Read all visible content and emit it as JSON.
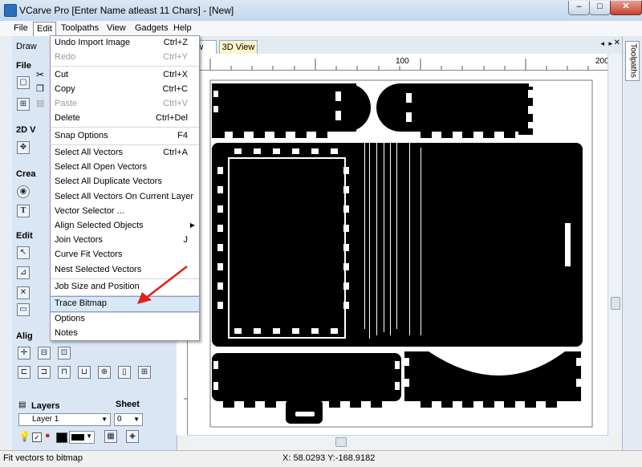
{
  "window": {
    "title": "VCarve Pro [Enter Name atleast 11 Chars] - [New]",
    "min_glyph": "–",
    "max_glyph": "□",
    "close_glyph": "✕"
  },
  "menubar": {
    "items": [
      "File",
      "Edit",
      "Toolpaths",
      "View",
      "Gadgets",
      "Help"
    ]
  },
  "left_panel": {
    "drawing_tab": "Draw",
    "section_file": "File",
    "section_2d": "2D V",
    "section_create": "Crea",
    "section_edit": "Edit",
    "section_align": "Alig",
    "layers_label": "Layers",
    "sheet_label": "Sheet",
    "layer_value": "Layer 1",
    "sheet_value": "0"
  },
  "view_tabs": {
    "tab_2d": "iew",
    "tab_3d": "3D View"
  },
  "ruler": {
    "mark_100": "100",
    "mark_200": "200"
  },
  "right_panel": {
    "toolpaths": "Toolpaths"
  },
  "edit_menu": {
    "items": [
      {
        "label": "Undo Import Image",
        "shortcut": "Ctrl+Z"
      },
      {
        "label": "Redo",
        "shortcut": "Ctrl+Y"
      },
      {
        "label": "Cut",
        "shortcut": "Ctrl+X"
      },
      {
        "label": "Copy",
        "shortcut": "Ctrl+C"
      },
      {
        "label": "Paste",
        "shortcut": "Ctrl+V"
      },
      {
        "label": "Delete",
        "shortcut": "Ctrl+Del"
      },
      {
        "label": "Snap Options",
        "shortcut": "F4"
      },
      {
        "label": "Select All Vectors",
        "shortcut": "Ctrl+A"
      },
      {
        "label": "Select All Open Vectors",
        "shortcut": ""
      },
      {
        "label": "Select All Duplicate Vectors",
        "shortcut": ""
      },
      {
        "label": "Select All Vectors On Current Layer",
        "shortcut": ""
      },
      {
        "label": "Vector Selector ...",
        "shortcut": ""
      },
      {
        "label": "Align Selected Objects",
        "shortcut": ""
      },
      {
        "label": "Join Vectors",
        "shortcut": "J"
      },
      {
        "label": "Curve Fit Vectors",
        "shortcut": ""
      },
      {
        "label": "Nest Selected Vectors",
        "shortcut": ""
      },
      {
        "label": "Job Size and Position",
        "shortcut": ""
      },
      {
        "label": "Trace Bitmap",
        "shortcut": ""
      },
      {
        "label": "Options",
        "shortcut": ""
      },
      {
        "label": "Notes",
        "shortcut": ""
      }
    ]
  },
  "status": {
    "message": "Fit vectors to bitmap",
    "coords": "X: 58.0293 Y:-168.9182"
  },
  "colors": {
    "highlight": "#d9e7f7",
    "arrow": "#e0201b",
    "panel": "#dbe6f4"
  }
}
